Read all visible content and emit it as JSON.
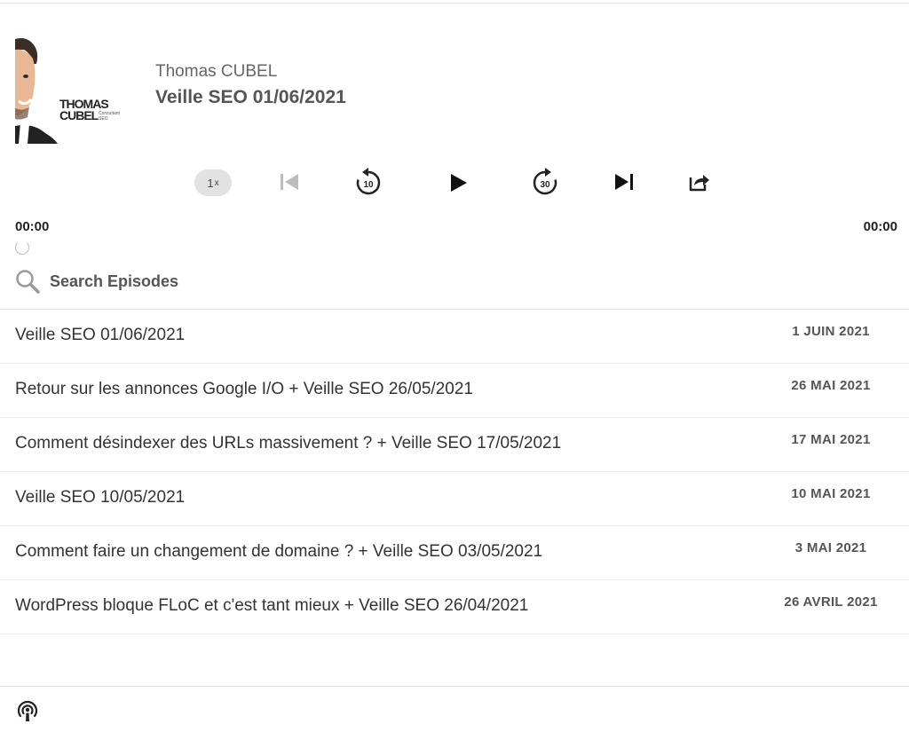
{
  "header": {
    "author": "Thomas CUBEL",
    "episode_title": "Veille SEO 01/06/2021",
    "artwork": {
      "logo_line1": "THOMAS",
      "logo_line2": "CUBEL",
      "logo_sub": "Consultant SEO"
    }
  },
  "player": {
    "speed_value": "1",
    "speed_unit": "x",
    "rewind_seconds": "10",
    "forward_seconds": "30",
    "current_time": "00:00",
    "duration": "00:00",
    "progress": 0
  },
  "search": {
    "label": "Search Episodes"
  },
  "episodes": [
    {
      "title": "Veille SEO 01/06/2021",
      "date": "1 JUIN 2021"
    },
    {
      "title": "Retour sur les annonces Google I/O + Veille SEO 26/05/2021",
      "date": "26 MAI 2021"
    },
    {
      "title": "Comment désindexer des URLs massivement ? + Veille SEO 17/05/2021",
      "date": "17 MAI 2021"
    },
    {
      "title": "Veille SEO 10/05/2021",
      "date": "10 MAI 2021"
    },
    {
      "title": "Comment faire un changement de domaine ? + Veille SEO 03/05/2021",
      "date": "3 MAI 2021"
    },
    {
      "title": "WordPress bloque FLoC et c'est tant mieux + Veille SEO 26/04/2021",
      "date": "26 AVRIL 2021"
    }
  ],
  "icons": {
    "previous": "skip-back-icon",
    "rewind": "rewind-10-icon",
    "play": "play-icon",
    "forward": "forward-30-icon",
    "next": "skip-forward-icon",
    "share": "share-icon",
    "search": "search-icon",
    "podcast": "podcast-icon"
  },
  "colors": {
    "text_primary": "#333333",
    "text_secondary": "#555555",
    "speed_pill": "#e2e2e2",
    "divider": "#e2e2e2"
  }
}
